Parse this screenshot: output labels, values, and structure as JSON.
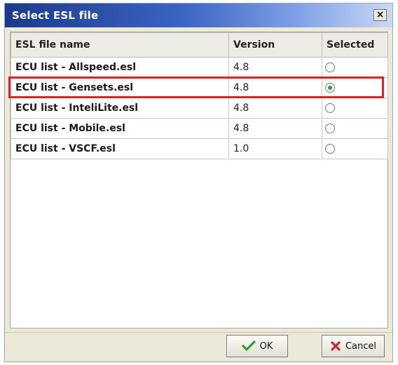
{
  "window": {
    "title": "Select ESL file",
    "close_symbol": "×"
  },
  "table": {
    "columns": [
      "ESL file name",
      "Version",
      "Selected"
    ],
    "rows": [
      {
        "name": "ECU list - Allspeed.esl",
        "version": "4.8",
        "selected": false
      },
      {
        "name": "ECU list - Gensets.esl",
        "version": "4.8",
        "selected": true
      },
      {
        "name": "ECU list - InteliLite.esl",
        "version": "4.8",
        "selected": false
      },
      {
        "name": "ECU list - Mobile.esl",
        "version": "4.8",
        "selected": false
      },
      {
        "name": "ECU list - VSCF.esl",
        "version": "1.0",
        "selected": false
      }
    ]
  },
  "buttons": {
    "ok_label": "OK",
    "cancel_label": "Cancel",
    "ok_icon": "check-icon",
    "cancel_icon": "x-icon"
  },
  "colors": {
    "title_bar": "#1c3a8c",
    "highlight": "#e21f26",
    "ok_icon": "#2f9d2f",
    "cancel_icon": "#d1262d"
  }
}
